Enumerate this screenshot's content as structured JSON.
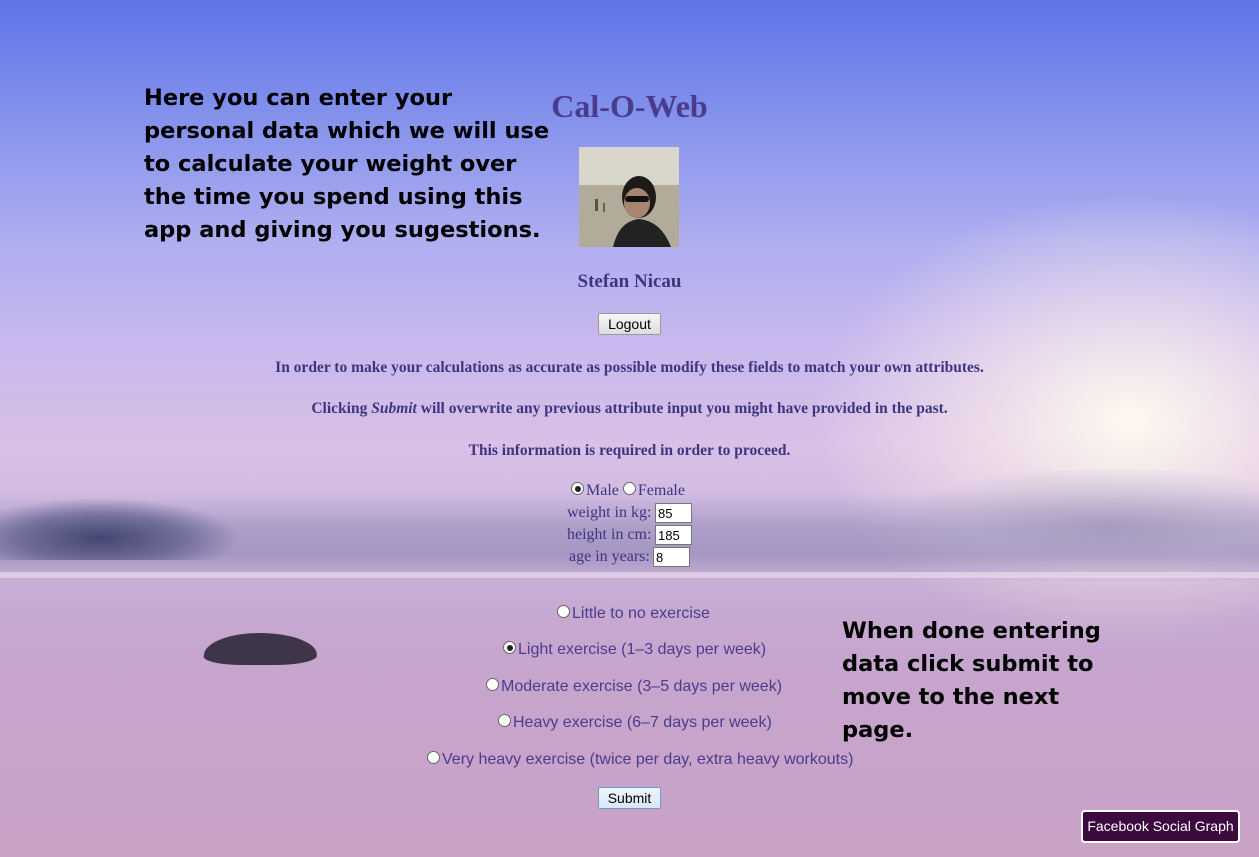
{
  "notes": {
    "left": "Here you can enter your personal data which we will use to calculate your weight over the time you spend using this app and giving you sugestions.",
    "right": "When done entering data click submit to move to the next page."
  },
  "app": {
    "title": "Cal-O-Web"
  },
  "user": {
    "name": "Stefan Nicau",
    "logout_label": "Logout"
  },
  "info": {
    "line1": "In order to make your calculations as accurate as possible modify these fields to match your own attributes.",
    "line2_prefix": "Clicking ",
    "line2_emphasis": "Submit",
    "line2_suffix": " will overwrite any previous attribute input you might have provided in the past.",
    "line3": "This information is required in order to proceed."
  },
  "form": {
    "gender": {
      "male_label": "Male",
      "female_label": "Female",
      "selected": "Male"
    },
    "weight": {
      "label": "weight in kg:",
      "value": "85"
    },
    "height": {
      "label": "height in cm:",
      "value": "185"
    },
    "age": {
      "label": "age in years:",
      "value": "8"
    },
    "exercise_options": [
      "Little to no exercise",
      "Light exercise (1–3 days per week)",
      "Moderate exercise (3–5 days per week)",
      "Heavy exercise (6–7 days per week)",
      "Very heavy exercise (twice per day, extra heavy workouts)"
    ],
    "exercise_selected": "Light exercise (1–3 days per week)",
    "submit_label": "Submit"
  },
  "footer": {
    "facebook_label": "Facebook Social Graph"
  }
}
